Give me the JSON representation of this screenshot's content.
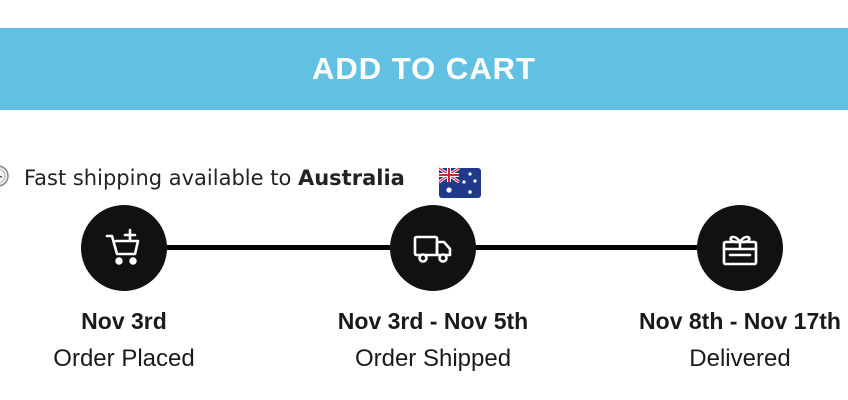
{
  "cart": {
    "button_label": "ADD TO CART"
  },
  "shipping": {
    "text_prefix": "Fast shipping available to ",
    "country": "Australia",
    "clock_icon": "clock-icon",
    "flag_icon": "australia-flag-icon"
  },
  "timeline": {
    "steps": [
      {
        "date": "Nov 3rd",
        "label": "Order Placed",
        "icon": "cart-add-icon"
      },
      {
        "date": "Nov 3rd - Nov 5th",
        "label": "Order Shipped",
        "icon": "truck-icon"
      },
      {
        "date": "Nov 8th - Nov 17th",
        "label": "Delivered",
        "icon": "gift-icon"
      }
    ]
  },
  "colors": {
    "button_bg": "#62c1e2",
    "button_text": "#ffffff",
    "timeline": "#000000",
    "text": "#1a1a1a"
  }
}
